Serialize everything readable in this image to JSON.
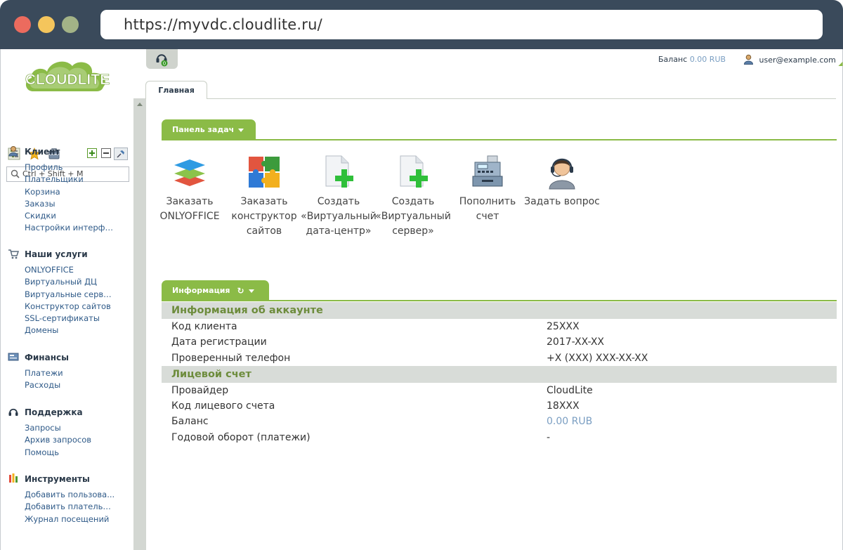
{
  "browser": {
    "url": "https://myvdc.cloudlite.ru/"
  },
  "logo": {
    "text": "CLOUDLITE",
    "color": "#8bbb47"
  },
  "sidebar": {
    "search_placeholder": "Ctrl + Shift + M",
    "sections": [
      {
        "title": "Клиент",
        "icon": "user-icon",
        "items": [
          "Профиль",
          "Плательщики",
          "Корзина",
          "Заказы",
          "Скидки",
          "Настройки интерфе..."
        ]
      },
      {
        "title": "Наши услуги",
        "icon": "cart-icon",
        "items": [
          "ONLYOFFICE",
          "Виртуальный ДЦ",
          "Виртуальные сервера",
          "Конструктор сайтов",
          "SSL-сертификаты",
          "Домены"
        ]
      },
      {
        "title": "Финансы",
        "icon": "finance-icon",
        "items": [
          "Платежи",
          "Расходы"
        ]
      },
      {
        "title": "Поддержка",
        "icon": "headset-icon",
        "items": [
          "Запросы",
          "Архив запросов",
          "Помощь"
        ]
      },
      {
        "title": "Инструменты",
        "icon": "tools-icon",
        "items": [
          "Добавить пользова...",
          "Добавить плательщ...",
          "Журнал посещений"
        ]
      }
    ]
  },
  "topbar": {
    "balance_label": "Баланс",
    "balance_value": "0.00 RUB",
    "user": "user@example.com",
    "support_badge": "0"
  },
  "tabs": [
    {
      "label": "Главная",
      "active": true
    }
  ],
  "taskpanel": {
    "title": "Панель задач",
    "tasks": [
      {
        "label": "Заказать ONLYOFFICE",
        "icon": "onlyoffice-icon"
      },
      {
        "label": "Заказать конструктор сайтов",
        "icon": "puzzle-icon"
      },
      {
        "label": "Создать «Виртуальный дата-центр»",
        "icon": "new-document-icon"
      },
      {
        "label": "Создать «Виртуальный сервер»",
        "icon": "new-document-icon"
      },
      {
        "label": "Пополнить счет",
        "icon": "cash-register-icon"
      },
      {
        "label": "Задать вопрос",
        "icon": "support-agent-icon"
      }
    ]
  },
  "infopanel": {
    "title": "Информация",
    "sections": [
      {
        "title": "Информация об аккаунте",
        "rows": [
          {
            "key": "Код клиента",
            "value": "25XXX"
          },
          {
            "key": "Дата регистрации",
            "value": "2017-XX-XX"
          },
          {
            "key": "Проверенный телефон",
            "value": "+X (XXX) XXX-XX-XX"
          }
        ]
      },
      {
        "title": "Лицевой счет",
        "rows": [
          {
            "key": "Провайдер",
            "value": "CloudLite"
          },
          {
            "key": "Код лицевого счета",
            "value": "18XXX"
          },
          {
            "key": "Баланс",
            "value": "0.00 RUB",
            "link": true
          },
          {
            "key": "Годовой оборот (платежи)",
            "value": "-"
          }
        ]
      }
    ]
  },
  "colors": {
    "accent": "#8bbb47",
    "link": "#2f5a88",
    "chrome": "#3a4a5b"
  }
}
